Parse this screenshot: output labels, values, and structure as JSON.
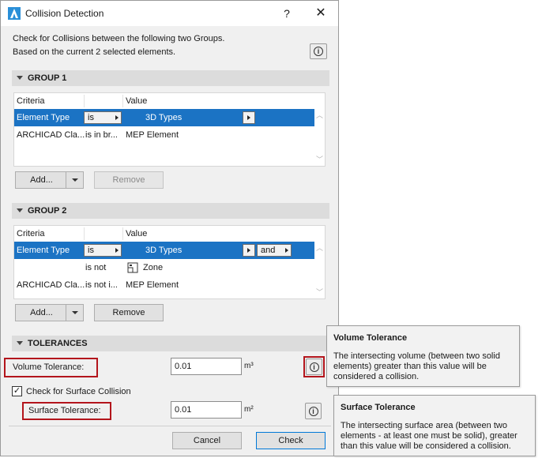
{
  "window": {
    "title": "Collision Detection",
    "help": "?",
    "close": "✕"
  },
  "intro": {
    "line1": "Check for Collisions between the following two Groups.",
    "line2": "Based on the current 2 selected elements."
  },
  "group1": {
    "header": "GROUP 1",
    "columns": [
      "Criteria",
      "Value"
    ],
    "rows": [
      {
        "criteria": "Element Type",
        "operator": "is",
        "value": "3D Types"
      },
      {
        "criteria": "ARCHICAD Cla...",
        "operator": "is in br...",
        "value": "MEP Element"
      }
    ],
    "add_label": "Add...",
    "remove_label": "Remove"
  },
  "group2": {
    "header": "GROUP 2",
    "columns": [
      "Criteria",
      "Value"
    ],
    "rows": [
      {
        "criteria": "Element Type",
        "operator": "is",
        "value": "3D Types",
        "conjunction": "and"
      },
      {
        "criteria": "",
        "operator": "is not",
        "value": "Zone"
      },
      {
        "criteria": "ARCHICAD Cla...",
        "operator": "is not i...",
        "value": "MEP Element"
      }
    ],
    "add_label": "Add...",
    "remove_label": "Remove"
  },
  "tolerances": {
    "header": "TOLERANCES",
    "volume_label": "Volume Tolerance:",
    "volume_value": "0.01",
    "volume_unit": "m³",
    "surface_checkbox_label": "Check for Surface Collision",
    "surface_checked": true,
    "surface_label": "Surface Tolerance:",
    "surface_value": "0.01",
    "surface_unit": "m²"
  },
  "footer": {
    "cancel_label": "Cancel",
    "check_label": "Check"
  },
  "tooltips": {
    "volume": {
      "title": "Volume Tolerance",
      "line1": "The intersecting volume (between two solid",
      "line2": "elements) greater than this value will be",
      "line3": "considered a collision."
    },
    "surface": {
      "title": "Surface Tolerance",
      "line1": "The intersecting surface area (between two",
      "line2": "elements - at least one must be solid), greater",
      "line3": "than this value will be considered a collision."
    }
  },
  "colors": {
    "selection": "#1b73c4",
    "highlight_box": "#b3151c",
    "dialog_bg": "#f0f0f0"
  },
  "icons": {
    "app": "archicad-logo-icon",
    "info": "info-icon",
    "zone": "zone-icon",
    "checkmark": "✓"
  }
}
